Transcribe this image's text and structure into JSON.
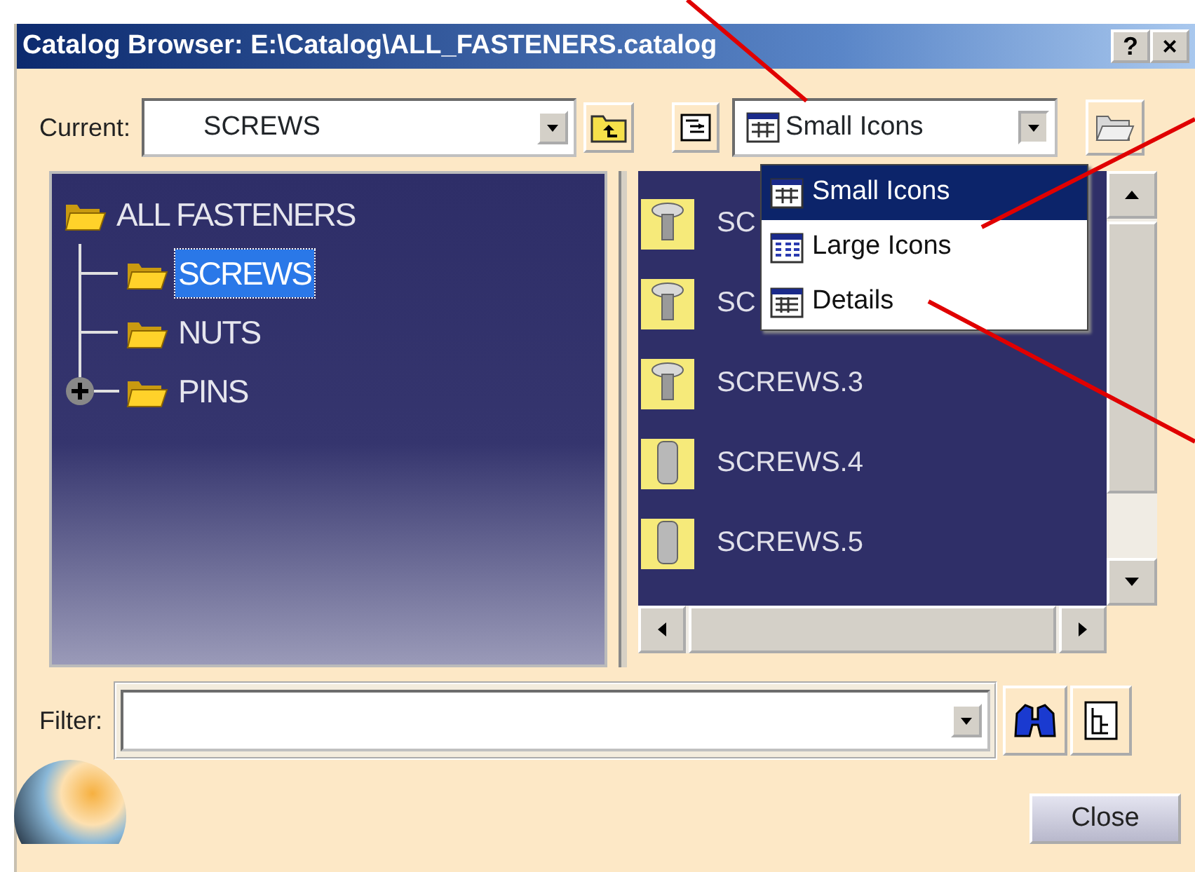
{
  "window": {
    "title": "Catalog Browser: E:\\Catalog\\ALL_FASTENERS.catalog",
    "buttons": [
      {
        "label": "?"
      },
      {
        "label": "×"
      }
    ]
  },
  "current": {
    "label": "Current:",
    "value": "SCREWS"
  },
  "view_select": {
    "value": "Small Icons",
    "expanded": true,
    "options": [
      {
        "label": "Small Icons",
        "kind": "small",
        "selected": true
      },
      {
        "label": "Large Icons",
        "kind": "large",
        "selected": false
      },
      {
        "label": "Details",
        "kind": "details",
        "selected": false
      }
    ]
  },
  "tree": {
    "items": [
      {
        "label": "ALL FASTENERS",
        "selected": false,
        "children": [
          {
            "label": "SCREWS",
            "selected": true
          },
          {
            "label": "NUTS",
            "selected": false
          },
          {
            "label": "PINS",
            "selected": false,
            "expanded": false
          }
        ]
      }
    ]
  },
  "list": {
    "items": [
      {
        "label": "SC",
        "kind": "screw"
      },
      {
        "label": "SC",
        "kind": "screw"
      },
      {
        "label": "SCREWS.3",
        "kind": "screw"
      },
      {
        "label": "SCREWS.4",
        "kind": "cylinder"
      },
      {
        "label": "SCREWS.5",
        "kind": "cylinder"
      }
    ]
  },
  "filter": {
    "label": "Filter:"
  },
  "close_button": {
    "label": "Close"
  }
}
